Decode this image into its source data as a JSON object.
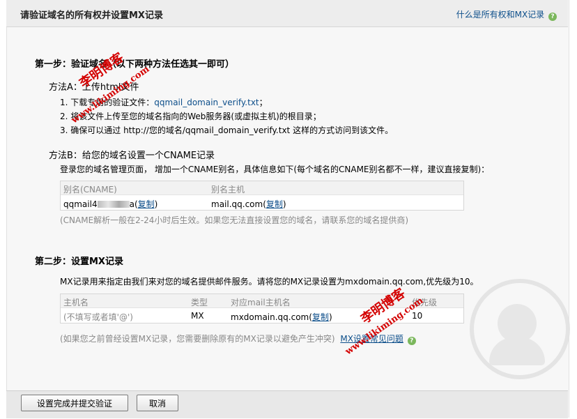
{
  "header": {
    "title": "请验证域名的所有权并设置MX记录",
    "help_link": "什么是所有权和MX记录",
    "help_icon": "?"
  },
  "step1": {
    "heading": "第一步：验证域名（以下两种方法任选其一即可）",
    "method_a": {
      "title": "方法A：上传html文件",
      "line1_prefix": "1. 下载专用的验证文件：",
      "line1_link": "qqmail_domain_verify.txt",
      "line1_suffix": "；",
      "line2": "2. 将该文件上传至您的域名指向的Web服务器(或虚拟主机)的根目录；",
      "line3": "3. 确保可以通过 http://您的域名/qqmail_domain_verify.txt 这样的方式访问到该文件。"
    },
    "method_b": {
      "title": "方法B：给您的域名设置一个CNAME记录",
      "intro": "登录您的域名管理页面， 增加一个CNAME别名，具体信息如下(每个域名的CNAME别名都不一样，建议直接复制)：",
      "col_alias": "别名(CNAME)",
      "col_host": "别名主机",
      "alias_value": "qqmail4",
      "alias_tail": "a",
      "host_value": "mail.qq.com",
      "copy_label": "复制",
      "note": "(CNAME解析一般在2-24小时后生效。如果您无法直接设置您的域名，请联系您的域名提供商)"
    }
  },
  "step2": {
    "heading": "第二步：设置MX记录",
    "intro": "MX记录用来指定由我们来对您的域名提供邮件服务。请将您的MX记录设置为mxdomain.qq.com,优先级为10。",
    "col_host": "主机名",
    "col_type": "类型",
    "col_mail": "对应mail主机名",
    "col_priority": "优先级",
    "host_value": "(不填写或者填'@')",
    "type_value": "MX",
    "mail_value": "mxdomain.qq.com",
    "copy_label": "复制",
    "priority_value": "10",
    "note": "(如果您之前曾经设置MX记录，您需要删除原有的MX记录以避免产生冲突)",
    "faq_link": "MX设置常见问题",
    "faq_icon": "?"
  },
  "footer": {
    "submit_label": "设置完成并提交验证",
    "cancel_label": "取消"
  },
  "watermarks": {
    "top_cn": "李明博客",
    "top_en": "www.likiming.com",
    "bottom_cn": "李明博客",
    "bottom_en": "www.likiming.com"
  },
  "colors": {
    "link": "#0c4e8a",
    "watermark": "#d40000",
    "help_icon": "#7bb75c"
  }
}
